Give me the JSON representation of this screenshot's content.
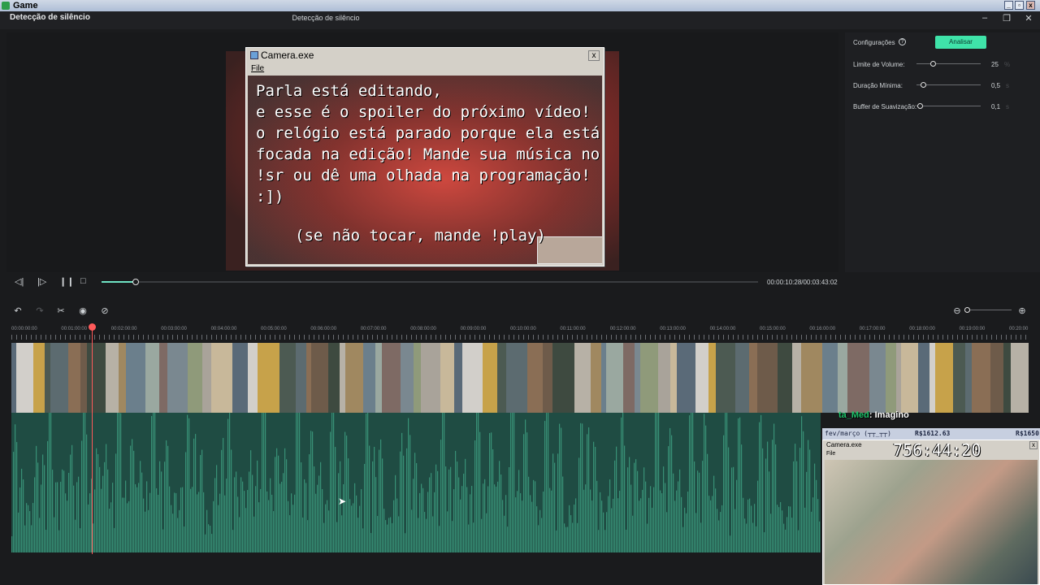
{
  "os_bar": {
    "title": "Game",
    "buttons": [
      "_",
      "▫",
      "x"
    ]
  },
  "app": {
    "title": "Detecção de silêncio",
    "center_title": "Detecção de silêncio",
    "window_controls": [
      "–",
      "❐",
      "✕"
    ]
  },
  "camera_window": {
    "title": "Camera.exe",
    "close": "x",
    "menu": "File",
    "caption_lines": [
      "Parla está editando,",
      "e esse é o spoiler do próximo vídeo!",
      "o relógio está parado porque ela está",
      "focada na edição! Mande sua música no",
      "!sr ou dê uma olhada na programação!",
      ":])"
    ],
    "caption_footer": "(se não tocar, mande !play)"
  },
  "transport": {
    "timecode": "00:00:10:28/00:03:43:02",
    "progress": 0.05,
    "icons": [
      "prev-frame-icon",
      "play-icon",
      "pause-icon",
      "stop-icon"
    ]
  },
  "settings": {
    "label": "Configurações",
    "help": "?",
    "analyze_button": "Analisar",
    "accent_color": "#3fe3a9",
    "rows": [
      {
        "label": "Limite de Volume:",
        "value": "25",
        "unit": "%",
        "level": 0.25
      },
      {
        "label": "Duração Mínima:",
        "value": "0,5",
        "unit": "s",
        "level": 0.1
      },
      {
        "label": "Buffer de Suavização:",
        "value": "0,1",
        "unit": "s",
        "level": 0.02
      }
    ]
  },
  "timeline": {
    "ruler": [
      "00:00:00:00",
      "00:01:00:00",
      "00:02:00:00",
      "00:03:00:00",
      "00:04:00:00",
      "00:05:00:00",
      "00:06:00:00",
      "00:07:00:00",
      "00:08:00:00",
      "00:09:00:00",
      "00:10:00:00",
      "00:11:00:00",
      "00:12:00:00",
      "00:13:00:00",
      "00:14:00:00",
      "00:15:00:00",
      "00:16:00:00",
      "00:17:00:00",
      "00:18:00:00",
      "00:19:00:00",
      "00:20:00"
    ],
    "waveform_color": "#4cc9a0",
    "playhead_color": "#ff5a5a"
  },
  "overlay": {
    "chat_user": "ta_Med",
    "chat_message": ": Imagino",
    "goal_label": "fev/março (┬┬_┬┬)",
    "goal_value": "R$1612.63",
    "goal_target": "R$1650",
    "cam_title": "Camera.exe",
    "cam_menu": "File",
    "clock": "756:44:20",
    "close": "x"
  }
}
